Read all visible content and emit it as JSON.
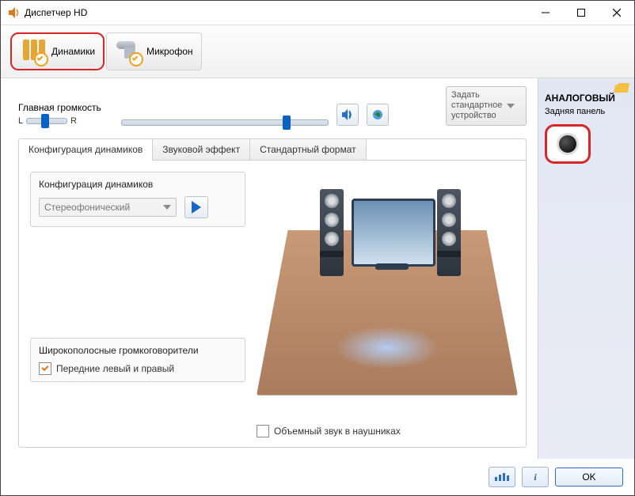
{
  "window": {
    "title": "Диспетчер HD"
  },
  "device_tabs": {
    "speakers_label": "Динамики",
    "microphone_label": "Микрофон"
  },
  "volume": {
    "main_label": "Главная громкость",
    "balance_left": "L",
    "balance_right": "R",
    "balance_value_pct": 35,
    "main_value_pct": 78
  },
  "default_device": {
    "line1": "Задать",
    "line2": "стандартное",
    "line3": "устройство"
  },
  "inner_tabs": {
    "config": "Конфигурация динамиков",
    "effect": "Звуковой эффект",
    "format": "Стандартный формат"
  },
  "config": {
    "group_title": "Конфигурация динамиков",
    "combo_value": "Стереофонический",
    "wide_group_title": "Широкополосные громкоговорители",
    "front_lr_label": "Передние левый и правый",
    "front_lr_checked": true,
    "surround_label": "Объемный звук в наушниках",
    "surround_checked": false
  },
  "side": {
    "title": "АНАЛОГОВЫЙ",
    "rear_label": "Задняя панель"
  },
  "bottom": {
    "ok_label": "OK",
    "info_char": "i"
  },
  "colors": {
    "highlight": "#d62626",
    "accent": "#0a63c2"
  }
}
